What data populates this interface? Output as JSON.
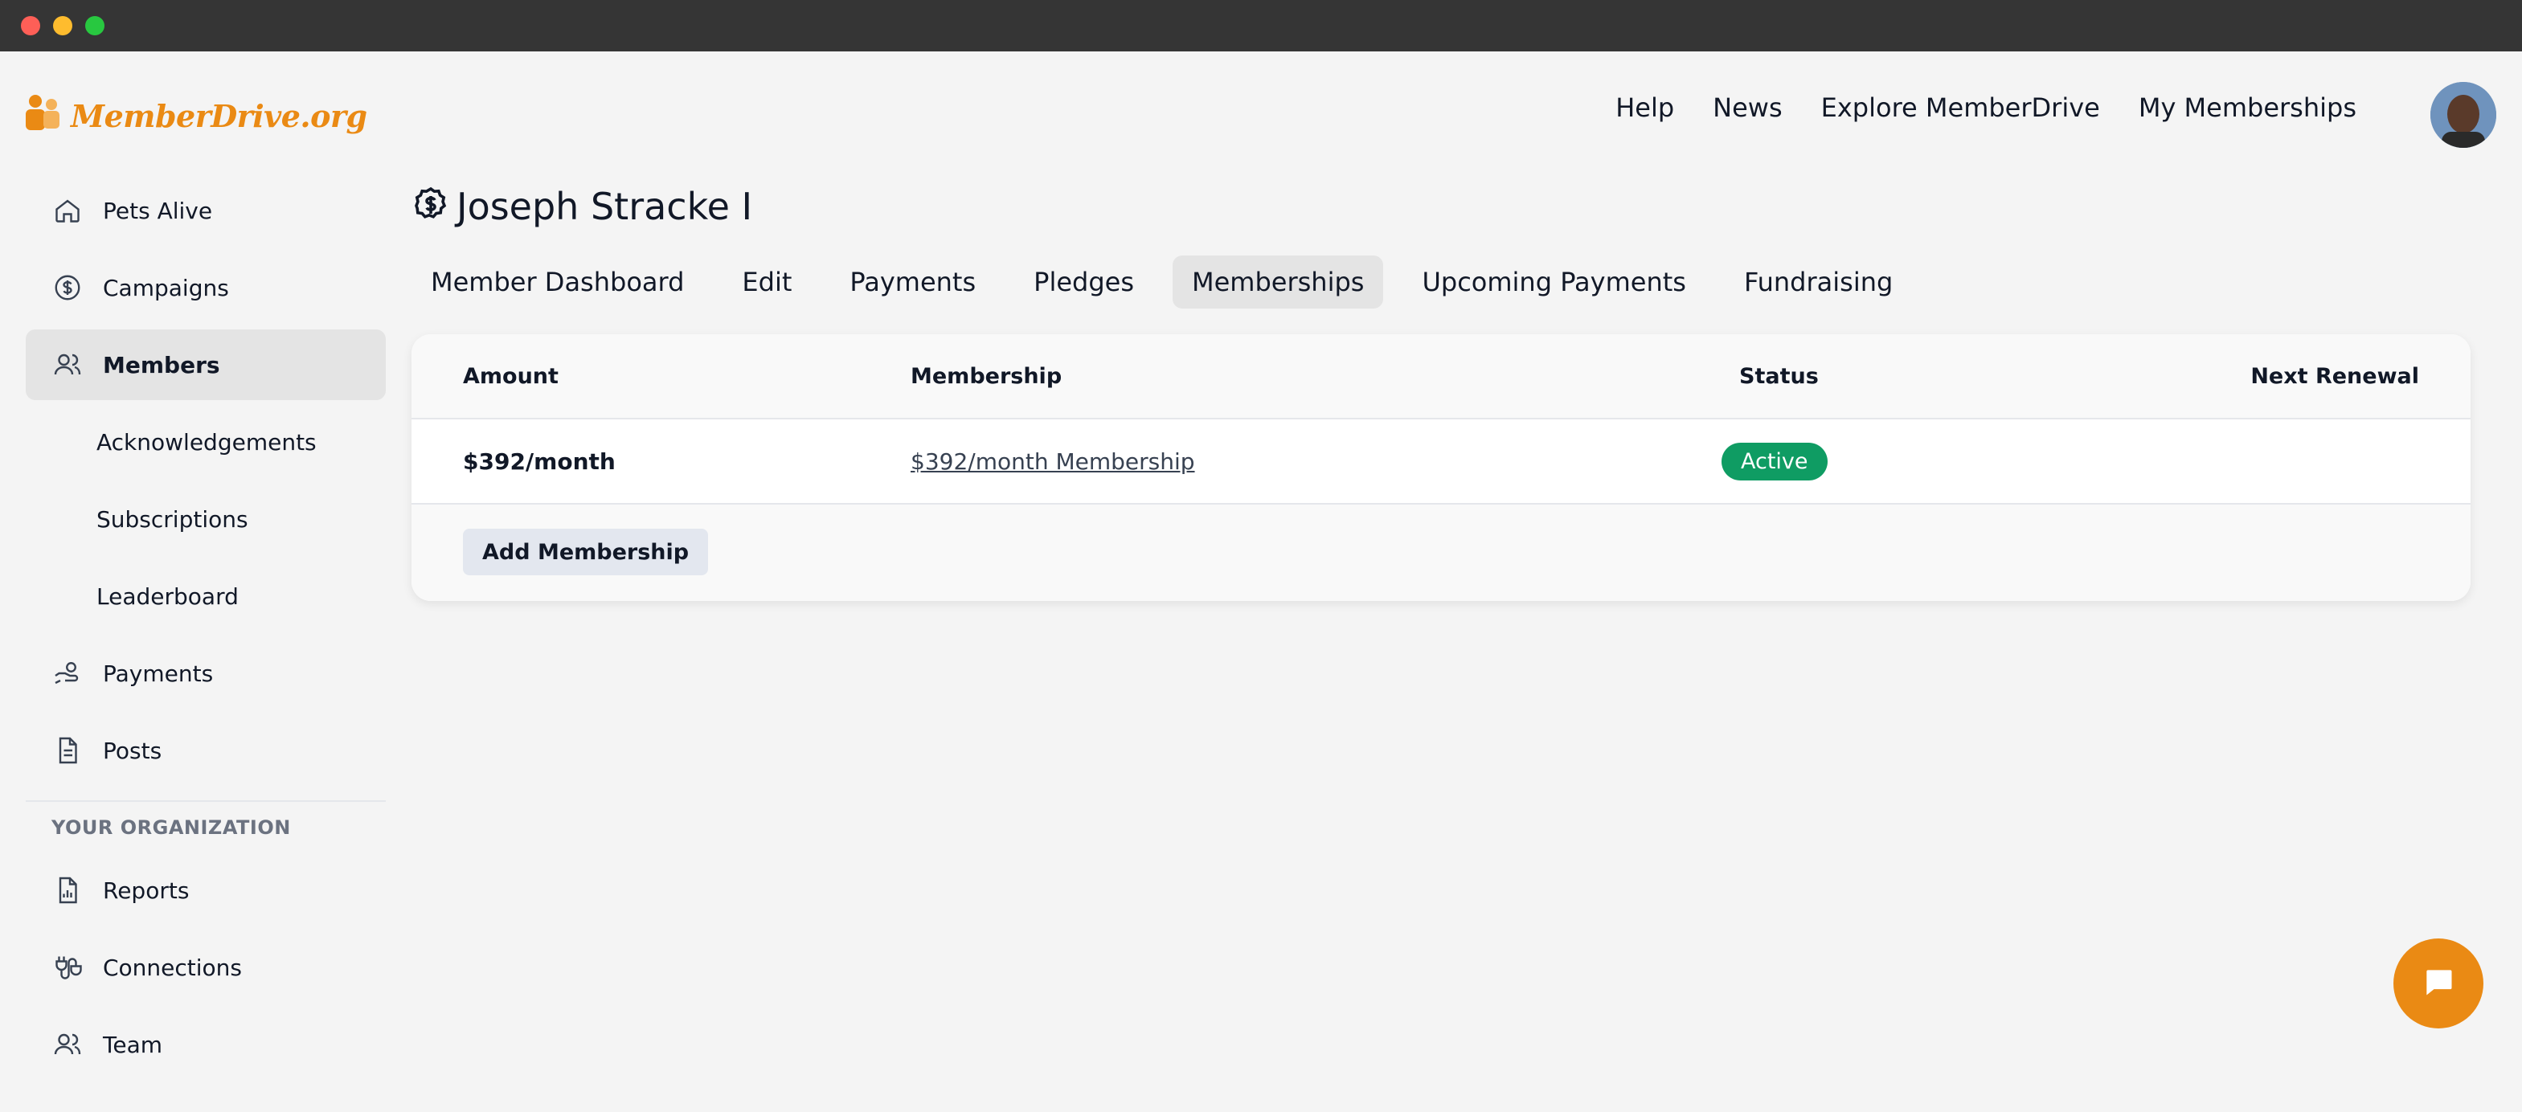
{
  "brand": {
    "name": "MemberDrive.org",
    "accent": "#ea8a14"
  },
  "topnav": [
    {
      "label": "Help"
    },
    {
      "label": "News"
    },
    {
      "label": "Explore MemberDrive"
    },
    {
      "label": "My Memberships"
    }
  ],
  "sidebar": {
    "items": [
      {
        "label": "Pets Alive",
        "icon": "home-icon"
      },
      {
        "label": "Campaigns",
        "icon": "dollar-badge-icon"
      },
      {
        "label": "Members",
        "icon": "users-icon",
        "active": true
      }
    ],
    "subitems": [
      {
        "label": "Acknowledgements"
      },
      {
        "label": "Subscriptions"
      },
      {
        "label": "Leaderboard"
      }
    ],
    "items2": [
      {
        "label": "Payments",
        "icon": "hand-coins-icon"
      },
      {
        "label": "Posts",
        "icon": "document-icon"
      }
    ],
    "section_label": "YOUR ORGANIZATION",
    "org_items": [
      {
        "label": "Reports",
        "icon": "report-icon"
      },
      {
        "label": "Connections",
        "icon": "plug-icon"
      },
      {
        "label": "Team",
        "icon": "team-icon"
      }
    ]
  },
  "page": {
    "title": "Joseph Stracke I",
    "tabs": [
      {
        "label": "Member Dashboard"
      },
      {
        "label": "Edit"
      },
      {
        "label": "Payments"
      },
      {
        "label": "Pledges"
      },
      {
        "label": "Memberships",
        "active": true
      },
      {
        "label": "Upcoming Payments"
      },
      {
        "label": "Fundraising"
      }
    ]
  },
  "table": {
    "headers": {
      "amount": "Amount",
      "membership": "Membership",
      "status": "Status",
      "next_renewal": "Next Renewal"
    },
    "rows": [
      {
        "amount": "$392/month",
        "membership": "$392/month Membership",
        "status": "Active",
        "next_renewal": ""
      }
    ],
    "add_button": "Add Membership",
    "status_color": "#0f9c63"
  }
}
